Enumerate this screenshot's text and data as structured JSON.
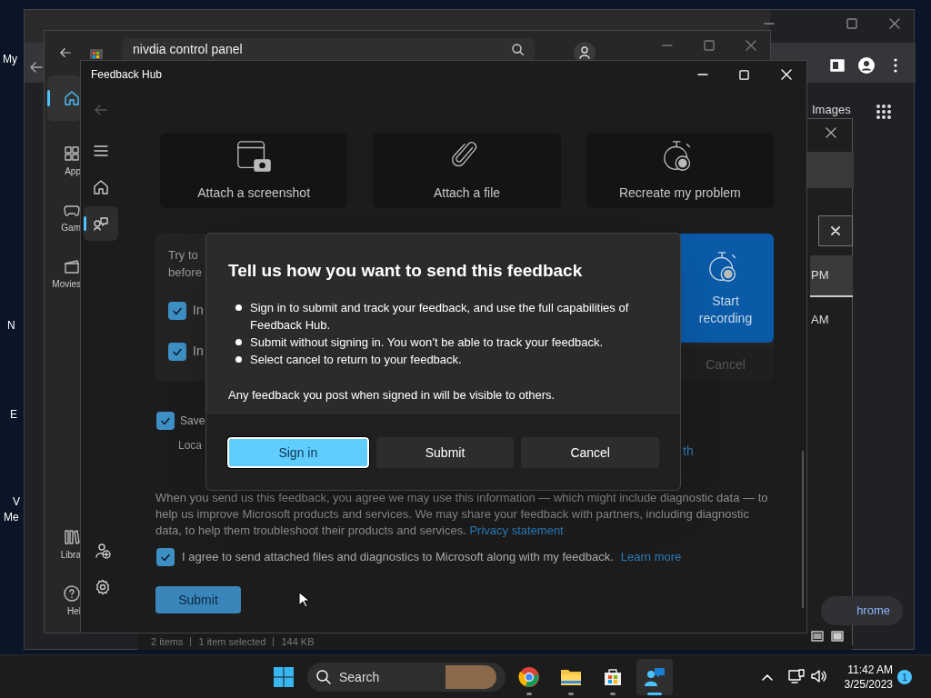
{
  "desktop": {
    "icon_labels": [
      "My",
      "N",
      "E",
      "V",
      "Me"
    ]
  },
  "browser_window": {
    "images_link": "Images",
    "popup_rows": [
      "PM",
      "AM"
    ],
    "pill_link": "hrome"
  },
  "store_window": {
    "search": {
      "value": "nivdia control panel"
    },
    "nav": [
      {
        "kind": "home",
        "selected": true
      },
      {
        "kind": "apps",
        "label": "App",
        "selected": false
      },
      {
        "kind": "gaming",
        "label": "Gam",
        "selected": false
      },
      {
        "kind": "movies",
        "label": "Movies",
        "selected": false
      },
      {
        "kind": "library",
        "label": "Libra",
        "selected": false
      },
      {
        "kind": "help",
        "label": "Hel",
        "selected": false
      }
    ]
  },
  "feedback_window": {
    "title": "Feedback Hub",
    "nav": [
      {
        "kind": "menu",
        "selected": false
      },
      {
        "kind": "home",
        "selected": false
      },
      {
        "kind": "feedback",
        "selected": true
      }
    ],
    "attach_cards": [
      {
        "kind": "screenshot",
        "label": "Attach a screenshot"
      },
      {
        "kind": "file",
        "label": "Attach a file"
      },
      {
        "kind": "recreate",
        "label": "Recreate my problem"
      }
    ],
    "recreate_panel": {
      "lines": [
        "Try to",
        "before"
      ],
      "options": [
        {
          "label": "In",
          "checked": true
        },
        {
          "label": "In",
          "checked": true
        }
      ],
      "start_button": "Start recording",
      "cancel_button": {
        "label": "Cancel",
        "disabled": true
      }
    },
    "save_option": {
      "label": "Save",
      "checked": true
    },
    "location_label": "Loca",
    "location_link": "th",
    "notice": {
      "text": "When you send us this feedback, you agree we may use this information — which might include diagnostic data — to help us improve Microsoft products and services. We may share your feedback with partners, including diagnostic data, to help them troubleshoot their products and services.",
      "link": "Privacy statement"
    },
    "agree": {
      "label": "I agree to send attached files and diagnostics to Microsoft along with my feedback.",
      "link": "Learn more",
      "checked": true
    },
    "submit_button": "Submit"
  },
  "dialog": {
    "title": "Tell us how you want to send this feedback",
    "bullets": [
      "Sign in to submit and track your feedback, and use the full capabilities of Feedback Hub.",
      "Submit without signing in. You won’t be able to track your feedback.",
      "Select cancel to return to your feedback."
    ],
    "note": "Any feedback you post when signed in will be visible to others.",
    "buttons": [
      {
        "label": "Sign in",
        "focused": true
      },
      {
        "label": "Submit",
        "focused": false
      },
      {
        "label": "Cancel",
        "focused": false
      }
    ]
  },
  "explorer_status": [
    "2 items",
    "1 item selected",
    "144 KB"
  ],
  "taskbar": {
    "search_placeholder": "Search",
    "apps": [
      {
        "kind": "chrome",
        "active": false
      },
      {
        "kind": "explorer",
        "active": false
      },
      {
        "kind": "store",
        "active": false
      },
      {
        "kind": "feedback",
        "active": true
      }
    ],
    "time": "11:42 AM",
    "date": "3/25/2023",
    "notification_count": "1"
  }
}
